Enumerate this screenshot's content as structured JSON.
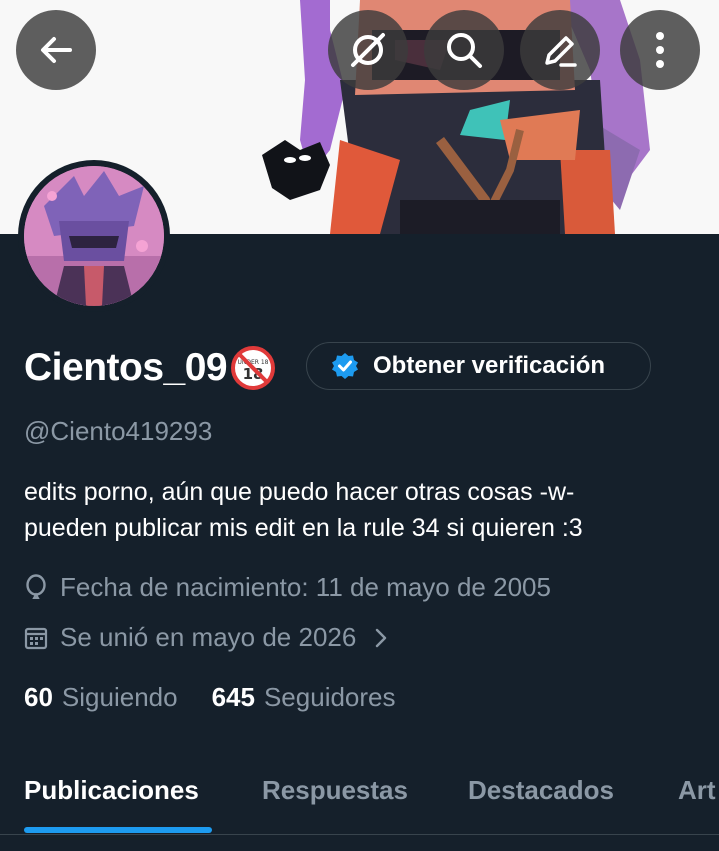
{
  "profile": {
    "display_name": "Cientos_09",
    "handle": "@Ciento419293",
    "badge_text": "UNDER 18",
    "verify_label": "Obtener verificación",
    "bio_line1": "edits porno, aún que puedo hacer otras cosas -w-",
    "bio_line2": "pueden publicar mis edit en la rule 34 si quieren :3",
    "birth": "Fecha de nacimiento: 11 de mayo de 2005",
    "joined": "Se unió en mayo de 2026",
    "following_count": "60",
    "following_label": "Siguiendo",
    "followers_count": "645",
    "followers_label": "Seguidores"
  },
  "nav": {
    "icons": [
      "back-arrow-icon",
      "grok-icon",
      "search-icon",
      "edit-icon",
      "more-vertical-icon"
    ]
  },
  "tabs": [
    {
      "label": "Publicaciones",
      "active": true
    },
    {
      "label": "Respuestas",
      "active": false
    },
    {
      "label": "Destacados",
      "active": false
    },
    {
      "label": "Art",
      "active": false
    }
  ],
  "colors": {
    "background": "#15202b",
    "accent": "#1d9bf0",
    "muted_text": "#8b98a5",
    "border": "#38444d"
  }
}
